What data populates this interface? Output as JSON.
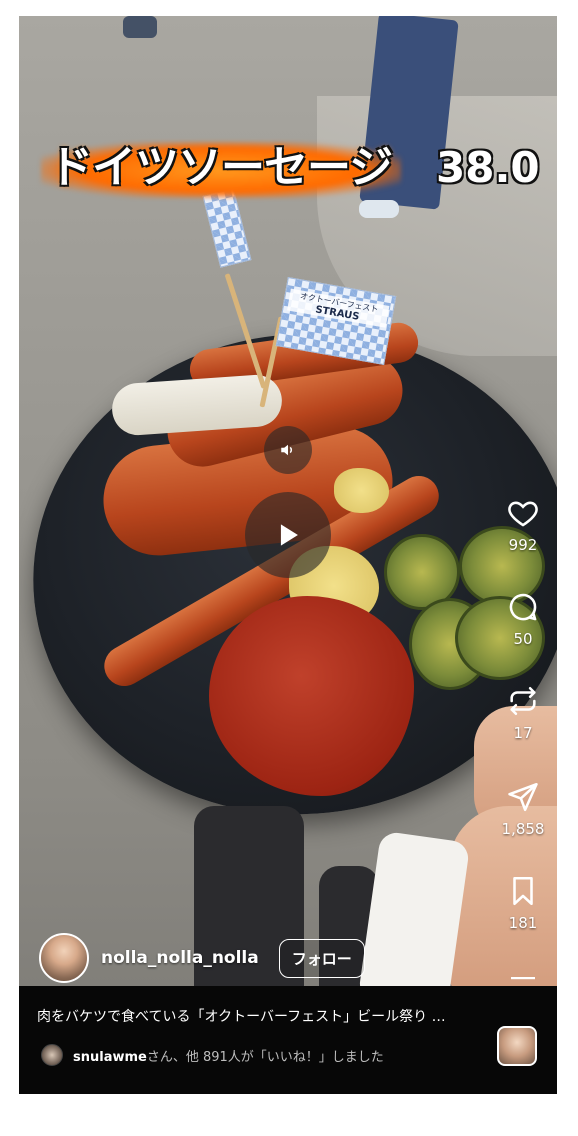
{
  "overlay": {
    "title": "ドイツソーセージ",
    "price": "38.0",
    "flag_text_line1": "オクトーバーフェスト",
    "flag_text_line2": "STRAUS"
  },
  "player": {
    "mute_icon": "speaker-icon",
    "play_icon": "play-icon"
  },
  "actions": {
    "like_count": "992",
    "comment_count": "50",
    "repost_count": "17",
    "share_count": "1,858",
    "save_count": "181"
  },
  "author": {
    "username": "nolla_nolla_nolla",
    "follow_label": "フォロー"
  },
  "post": {
    "caption": "肉をバケツで食べている「オクトーバーフェスト」ビール祭り …",
    "liker": "snulawme",
    "likes_suffix": "さん、他 891人が「いいね！」しました"
  },
  "colors": {
    "accent_flame": "#ff7a00",
    "bottom_bar": "#070707"
  }
}
